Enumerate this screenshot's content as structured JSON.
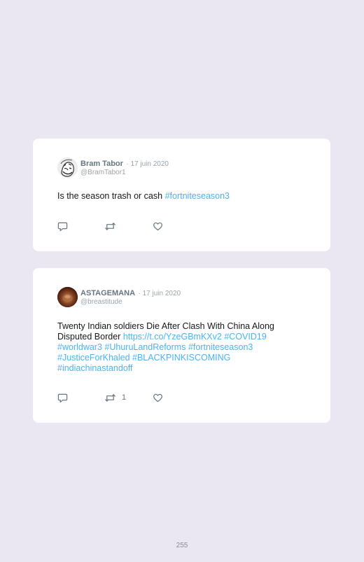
{
  "tweets": [
    {
      "name": "Bram Tabor",
      "date": "· 17 juin 2020",
      "handle": "@BramTabor1",
      "text": "Is the season trash or cash",
      "links": [
        "#fortniteseason3"
      ],
      "retweets": ""
    },
    {
      "name": "ASTAGEMANA",
      "date": "· 17 juin 2020",
      "handle": "@breastitude",
      "text": "Twenty Indian soldiers Die After Clash With China Along Disputed Border",
      "links": [
        "https://t.co/YzeGBmKXv2",
        "#COVID19",
        "#worldwar3",
        "#UhuruLandReforms",
        "#fortniteseason3",
        "#JusticeForKhaled",
        "#BLACKPINKISCOMING",
        "#indiachinastandoff"
      ],
      "retweets": "1"
    }
  ],
  "icons": {
    "reply": "reply-icon",
    "retweet": "retweet-icon",
    "like": "heart-icon"
  },
  "colors": {
    "background": "#ebe7f2",
    "card": "#ffffff",
    "link": "#4ab3f4",
    "muted": "#99a3ab",
    "name": "#66757f"
  },
  "page_number": "255"
}
